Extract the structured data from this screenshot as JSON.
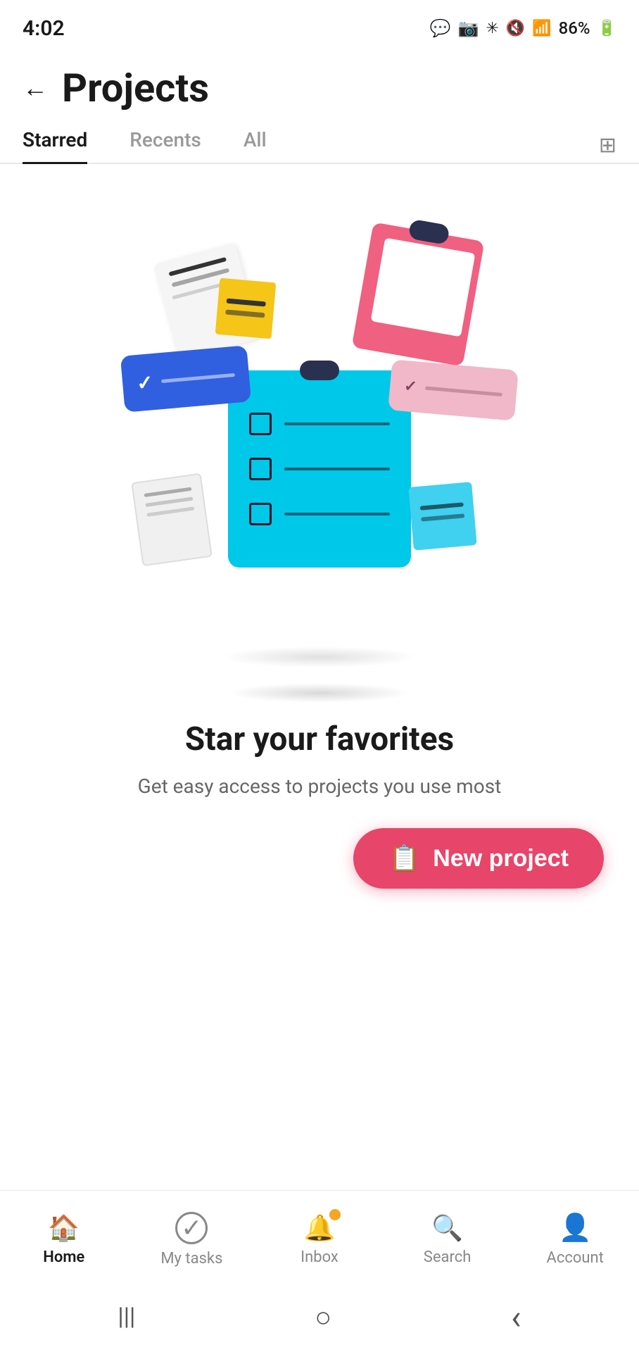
{
  "statusBar": {
    "time": "4:02",
    "battery": "86%"
  },
  "header": {
    "back_label": "←",
    "title": "Projects"
  },
  "tabs": {
    "items": [
      {
        "label": "Starred",
        "active": true
      },
      {
        "label": "Recents",
        "active": false
      },
      {
        "label": "All",
        "active": false
      }
    ]
  },
  "emptyState": {
    "title": "Star your favorites",
    "subtitle": "Get easy access to projects you use most"
  },
  "newProjectButton": {
    "label": "New project"
  },
  "bottomNav": {
    "items": [
      {
        "label": "Home",
        "active": true,
        "icon": "🏠"
      },
      {
        "label": "My tasks",
        "active": false,
        "icon": "✓"
      },
      {
        "label": "Inbox",
        "active": false,
        "icon": "🔔"
      },
      {
        "label": "Search",
        "active": false,
        "icon": "🔍"
      },
      {
        "label": "Account",
        "active": false,
        "icon": "👤"
      }
    ]
  },
  "systemNav": {
    "menu": "|||",
    "home": "○",
    "back": "‹"
  }
}
